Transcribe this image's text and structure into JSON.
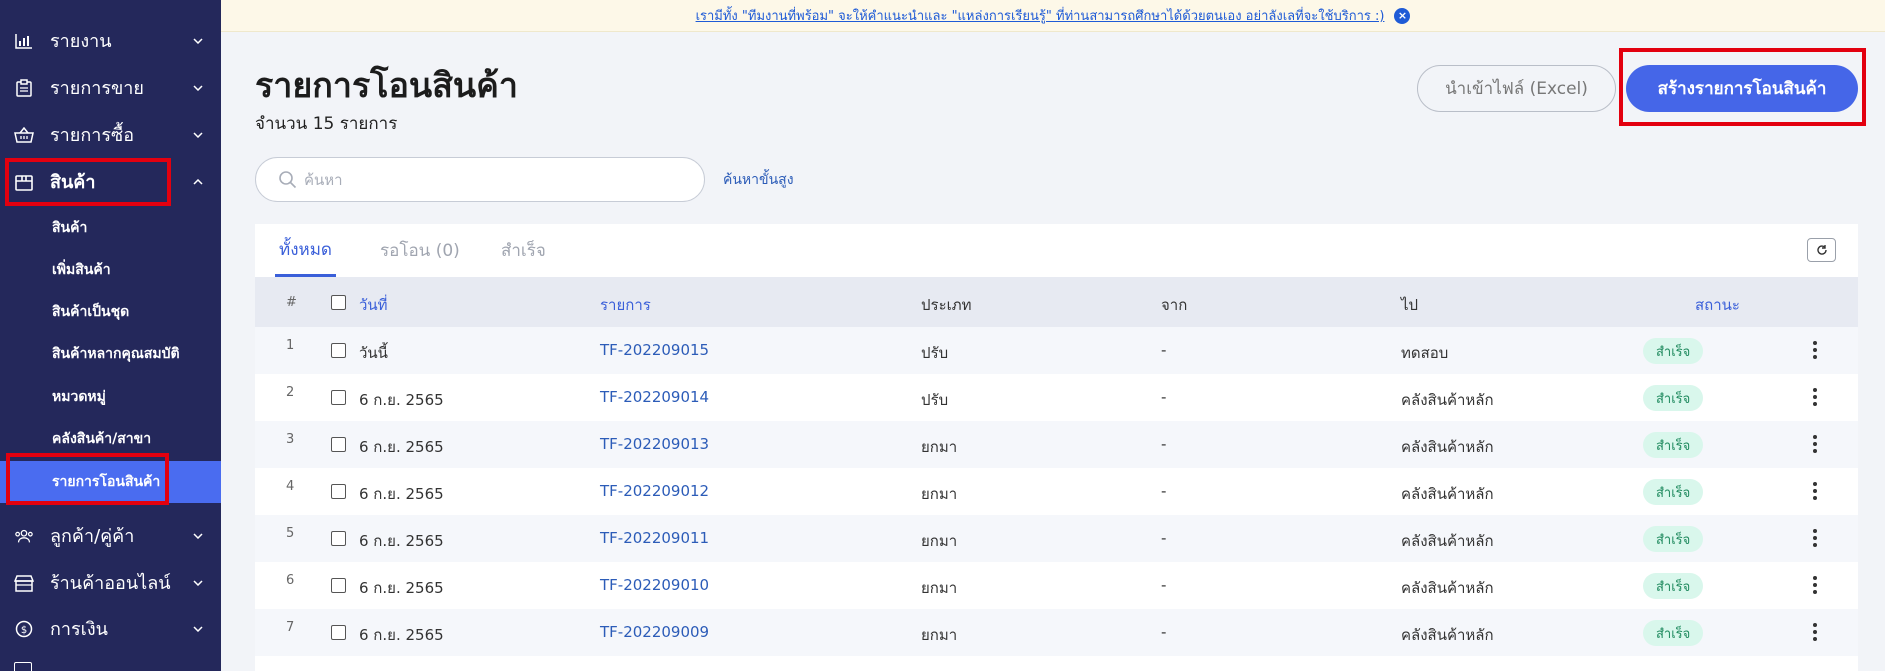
{
  "banner": {
    "text": "เรามีทั้ง \"ทีมงานที่พร้อม\" จะให้คำแนะนำและ \"แหล่งการเรียนรู้\" ที่ท่านสามารถศึกษาได้ด้วยตนเอง อย่าลังเลที่จะใช้บริการ :)",
    "close_icon": "×"
  },
  "sidebar": {
    "items": [
      {
        "label": "รายงาน",
        "icon": "bar-chart-icon"
      },
      {
        "label": "รายการขาย",
        "icon": "clipboard-icon"
      },
      {
        "label": "รายการซื้อ",
        "icon": "basket-icon"
      },
      {
        "label": "สินค้า",
        "icon": "box-icon"
      },
      {
        "label": "ลูกค้า/คู่ค้า",
        "icon": "users-icon"
      },
      {
        "label": "ร้านค้าออนไลน์",
        "icon": "store-icon"
      },
      {
        "label": "การเงิน",
        "icon": "dollar-icon"
      }
    ],
    "sub_items": [
      {
        "label": "สินค้า"
      },
      {
        "label": "เพิ่มสินค้า"
      },
      {
        "label": "สินค้าเป็นชุด"
      },
      {
        "label": "สินค้าหลากคุณสมบัติ"
      },
      {
        "label": "หมวดหมู่"
      },
      {
        "label": "คลังสินค้า/สาขา"
      },
      {
        "label": "รายการโอนสินค้า"
      }
    ]
  },
  "header": {
    "title": "รายการโอนสินค้า",
    "count": "จำนวน 15 รายการ",
    "import_label": "นำเข้าไฟล์ (Excel)",
    "create_label": "สร้างรายการโอนสินค้า"
  },
  "search": {
    "placeholder": "ค้นหา",
    "value": "",
    "advanced_label": "ค้นหาขั้นสูง"
  },
  "tabs": [
    {
      "label": "ทั้งหมด"
    },
    {
      "label": "รอโอน (0)"
    },
    {
      "label": "สำเร็จ"
    }
  ],
  "table": {
    "headers": {
      "num": "#",
      "date": "วันที่",
      "item": "รายการ",
      "type": "ประเภท",
      "from": "จาก",
      "to": "ไป",
      "status": "สถานะ"
    },
    "rows": [
      {
        "num": "1",
        "date": "วันนี้",
        "item": "TF-202209015",
        "type": "ปรับ",
        "from": "-",
        "to": "ทดสอบ",
        "status": "สำเร็จ"
      },
      {
        "num": "2",
        "date": "6 ก.ย. 2565",
        "item": "TF-202209014",
        "type": "ปรับ",
        "from": "-",
        "to": "คลังสินค้าหลัก",
        "status": "สำเร็จ"
      },
      {
        "num": "3",
        "date": "6 ก.ย. 2565",
        "item": "TF-202209013",
        "type": "ยกมา",
        "from": "-",
        "to": "คลังสินค้าหลัก",
        "status": "สำเร็จ"
      },
      {
        "num": "4",
        "date": "6 ก.ย. 2565",
        "item": "TF-202209012",
        "type": "ยกมา",
        "from": "-",
        "to": "คลังสินค้าหลัก",
        "status": "สำเร็จ"
      },
      {
        "num": "5",
        "date": "6 ก.ย. 2565",
        "item": "TF-202209011",
        "type": "ยกมา",
        "from": "-",
        "to": "คลังสินค้าหลัก",
        "status": "สำเร็จ"
      },
      {
        "num": "6",
        "date": "6 ก.ย. 2565",
        "item": "TF-202209010",
        "type": "ยกมา",
        "from": "-",
        "to": "คลังสินค้าหลัก",
        "status": "สำเร็จ"
      },
      {
        "num": "7",
        "date": "6 ก.ย. 2565",
        "item": "TF-202209009",
        "type": "ยกมา",
        "from": "-",
        "to": "คลังสินค้าหลัก",
        "status": "สำเร็จ"
      }
    ]
  },
  "colors": {
    "sidebar_bg": "#24285b",
    "accent": "#4566e8",
    "highlight": "#e3000f",
    "success_bg": "#d9f7ec",
    "success_text": "#1f8a5e"
  }
}
